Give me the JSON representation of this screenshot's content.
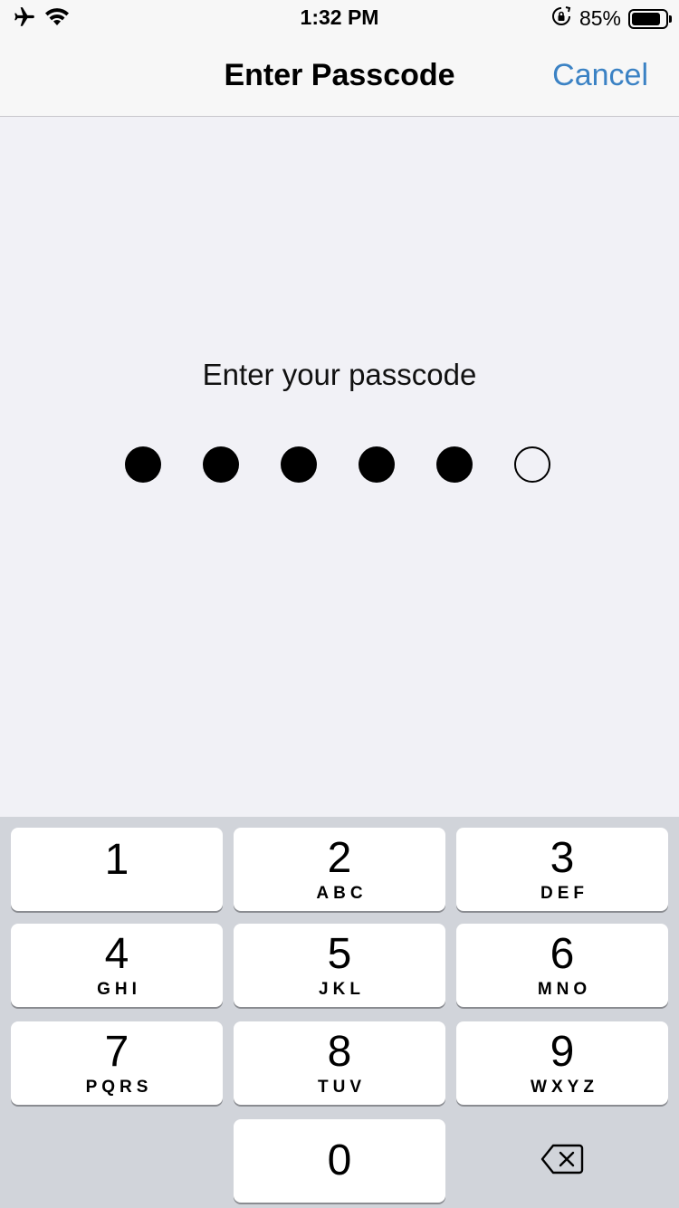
{
  "status_bar": {
    "time": "1:32 PM",
    "battery_percent": "85%",
    "battery_level": 0.85,
    "icons": [
      "airplane-icon",
      "wifi-icon",
      "orientation-lock-icon",
      "battery-icon"
    ]
  },
  "nav": {
    "title": "Enter Passcode",
    "cancel_label": "Cancel",
    "accent_color": "#3b82c4"
  },
  "passcode": {
    "prompt": "Enter your passcode",
    "length": 6,
    "entered": 5
  },
  "keypad": {
    "keys": [
      {
        "digit": "1",
        "letters": ""
      },
      {
        "digit": "2",
        "letters": "ABC"
      },
      {
        "digit": "3",
        "letters": "DEF"
      },
      {
        "digit": "4",
        "letters": "GHI"
      },
      {
        "digit": "5",
        "letters": "JKL"
      },
      {
        "digit": "6",
        "letters": "MNO"
      },
      {
        "digit": "7",
        "letters": "PQRS"
      },
      {
        "digit": "8",
        "letters": "TUV"
      },
      {
        "digit": "9",
        "letters": "WXYZ"
      }
    ],
    "zero": {
      "digit": "0"
    },
    "delete_icon": "delete-backspace-icon"
  }
}
